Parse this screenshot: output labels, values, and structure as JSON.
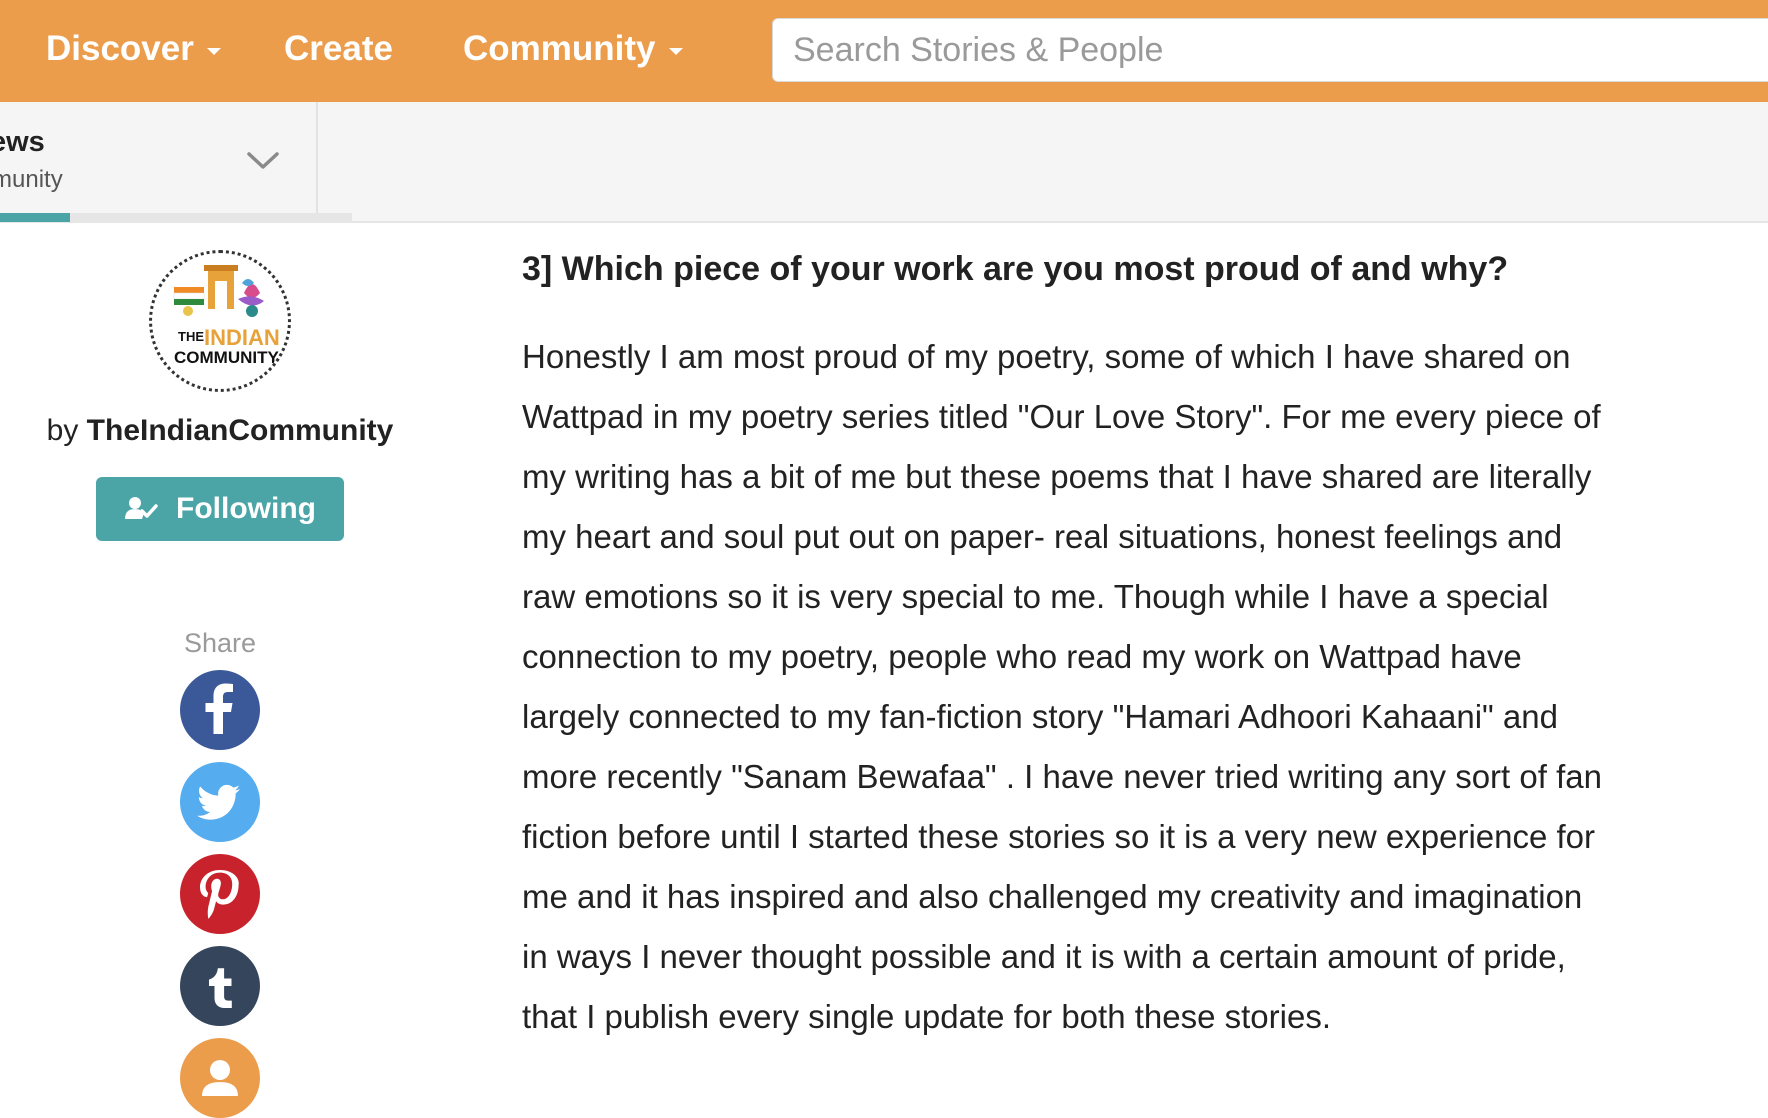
{
  "nav": {
    "discover": "Discover",
    "create": "Create",
    "community": "Community",
    "search_placeholder": "Search Stories & People"
  },
  "story_header": {
    "title": "ews",
    "subtitle": "munity",
    "reading_progress": 0.2
  },
  "author": {
    "by_label": "by",
    "name": "TheIndianCommunity",
    "follow_label": "Following",
    "logo_text": [
      "THE",
      "INDIAN",
      "COMMUNITY"
    ]
  },
  "share": {
    "label": "Share",
    "buttons": [
      "facebook-icon",
      "twitter-icon",
      "pinterest-icon",
      "tumblr-icon",
      "user-icon"
    ]
  },
  "article": {
    "question": "3] Which piece of your work are you most proud of and why?",
    "answer": "Honestly I am most proud of my poetry, some of which I have shared on Wattpad in my poetry series titled \"Our Love Story\". For me every piece of my writing has a bit of me but these poems that I have shared are literally my heart and soul put out on paper- real situations, honest feelings and raw emotions so it is very special to me. Though while I have a special connection to my poetry, people who read my work on Wattpad have largely connected to my fan-fiction story \"Hamari Adhoori Kahaani\" and more recently \"Sanam Bewafaa\" . I have never tried writing any sort of fan fiction before until I started these stories so it is a very new experience for me and it has inspired and also challenged my creativity and imagination in ways I never thought possible and it is with a certain amount of pride, that I publish every single update for both these stories."
  },
  "colors": {
    "nav_orange": "#EB9D4C",
    "teal": "#4BA5A7",
    "facebook": "#3B5998",
    "twitter": "#55ACEE",
    "pinterest": "#C8232C",
    "tumblr": "#35465C"
  }
}
